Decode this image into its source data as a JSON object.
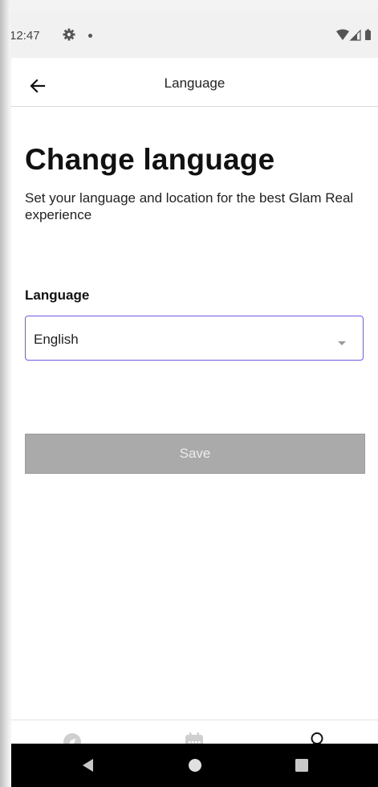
{
  "status_bar": {
    "time": "12:47",
    "icons": [
      "gear-icon",
      "notification-dot-icon",
      "wifi-icon",
      "signal-icon",
      "battery-icon"
    ]
  },
  "app_bar": {
    "title": "Language",
    "back_icon": "arrow-left-icon"
  },
  "main": {
    "heading": "Change language",
    "subtitle": "Set your language and location for the best Glam Real experience",
    "language_field": {
      "label": "Language",
      "selected_value": "English"
    },
    "save_label": "Save"
  },
  "bottom_nav": {
    "items": [
      {
        "icon": "compass-icon",
        "active": false
      },
      {
        "icon": "calendar-icon",
        "active": false
      },
      {
        "icon": "profile-icon",
        "active": true
      }
    ]
  },
  "system_nav": {
    "items": [
      "back-triangle-icon",
      "home-circle-icon",
      "recents-square-icon"
    ]
  },
  "colors": {
    "accent_border": "#6e5ce6",
    "disabled_button": "#aaaaaa",
    "status_bar_bg": "#f1f1f1"
  }
}
